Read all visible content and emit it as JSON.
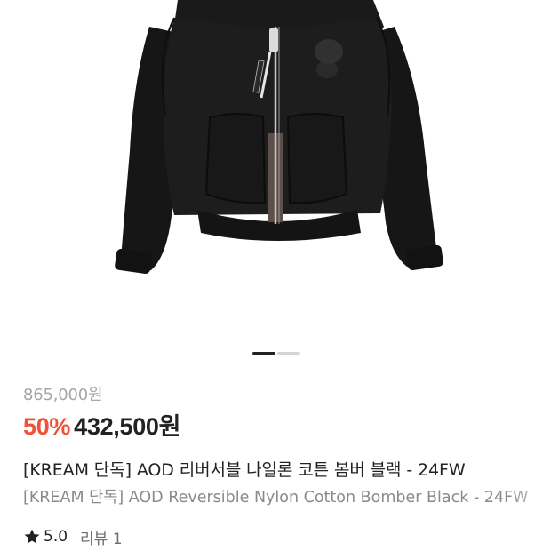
{
  "product": {
    "image_alt": "AOD reversible nylon cotton bomber jacket in black",
    "gallery": {
      "total_pages": 2,
      "current_page": 1
    },
    "original_price": "865,000원",
    "discount": "50%",
    "sale_price": "432,500원",
    "title_ko": "[KREAM 단독] AOD 리버서블 나일론 코튼 봄버 블랙 - 24FW",
    "title_en": "[KREAM 단독] AOD Reversible Nylon Cotton Bomber Black - 24FW",
    "rating": {
      "icon": "star-icon",
      "value": "5.0",
      "review_label": "리뷰 1"
    }
  },
  "colors": {
    "discount": "#ef5139",
    "text_primary": "#222222",
    "text_muted": "#a6a6a6",
    "text_secondary": "#8a8a8a",
    "pager_active": "#222222",
    "pager_inactive": "#d5d5d5"
  }
}
